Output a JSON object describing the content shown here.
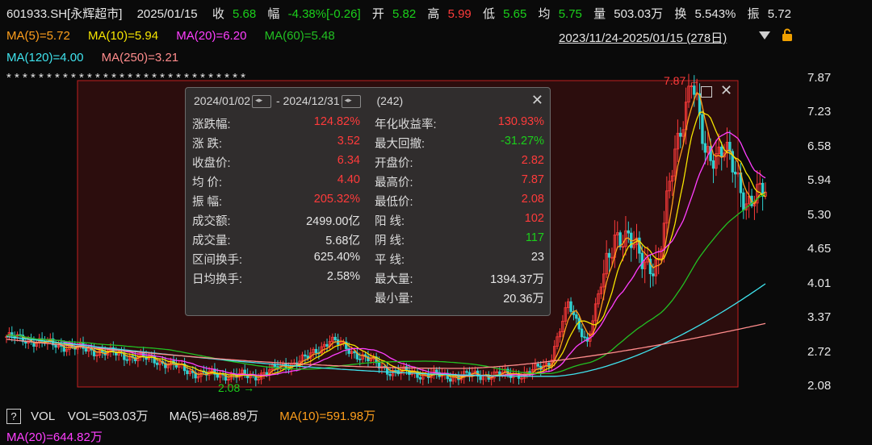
{
  "header": {
    "code_name": "601933.SH[永辉超市]",
    "date": "2025/01/15",
    "close_label": "收",
    "close_value": "5.68",
    "change_label": "幅",
    "change_value": "-4.38%[-0.26]",
    "open_label": "开",
    "open_value": "5.82",
    "high_label": "高",
    "high_value": "5.99",
    "low_label": "低",
    "low_value": "5.65",
    "avg_label": "均",
    "avg_value": "5.75",
    "volume_label": "量",
    "volume_value": "503.03万",
    "turnover_label": "换",
    "turnover_value": "5.543%",
    "amplitude_label": "振",
    "amplitude_value": "5.72"
  },
  "ma": {
    "ma5": "MA(5)=5.72",
    "ma10": "MA(10)=5.94",
    "ma20": "MA(20)=6.20",
    "ma60": "MA(60)=5.48",
    "ma120": "MA(120)=4.00",
    "ma250": "MA(250)=3.21"
  },
  "range_selector": "2023/11/24-2025/01/15 (278日)",
  "stars": "* * * *   *   *    *           * *         *    *  * * *             *      * *     *     *     *     *              * * * *    * *    *         *          *",
  "price_axis": [
    "7.87",
    "7.23",
    "6.58",
    "5.94",
    "5.30",
    "4.65",
    "4.01",
    "3.37",
    "2.72",
    "2.08"
  ],
  "annotations": {
    "high_marker": "7.87",
    "low_marker": "2.08"
  },
  "stats": {
    "date_from": "2024/01/02",
    "date_to": "2024/12/31",
    "separator": "-",
    "count": "(242)",
    "left": [
      {
        "label": "涨跌幅:",
        "value": "124.82%",
        "color": "#ff3b3b"
      },
      {
        "label": "涨  跌:",
        "value": "3.52",
        "color": "#ff3b3b"
      },
      {
        "label": "收盘价:",
        "value": "6.34",
        "color": "#ff3b3b"
      },
      {
        "label": "均  价:",
        "value": "4.40",
        "color": "#ff3b3b"
      },
      {
        "label": "振  幅:",
        "value": "205.32%",
        "color": "#ff3b3b"
      },
      {
        "label": "成交额:",
        "value": "2499.00亿",
        "color": "#e6e6e6"
      },
      {
        "label": "成交量:",
        "value": "5.68亿",
        "color": "#e6e6e6"
      },
      {
        "label": "区间换手:",
        "value": "625.40%",
        "color": "#e6e6e6"
      },
      {
        "label": "日均换手:",
        "value": "2.58%",
        "color": "#e6e6e6"
      }
    ],
    "right": [
      {
        "label": "年化收益率:",
        "value": "130.93%",
        "color": "#ff3b3b"
      },
      {
        "label": "最大回撤:",
        "value": "-31.27%",
        "color": "#1bd01b"
      },
      {
        "label": "开盘价:",
        "value": "2.82",
        "color": "#ff3b3b"
      },
      {
        "label": "最高价:",
        "value": "7.87",
        "color": "#ff3b3b"
      },
      {
        "label": "最低价:",
        "value": "2.08",
        "color": "#ff3b3b"
      },
      {
        "label": "阳  线:",
        "value": "102",
        "color": "#ff3b3b"
      },
      {
        "label": "阴  线:",
        "value": "117",
        "color": "#1bd01b"
      },
      {
        "label": "平  线:",
        "value": "23",
        "color": "#e6e6e6"
      },
      {
        "label": "最大量:",
        "value": "1394.37万",
        "color": "#e6e6e6"
      },
      {
        "label": "最小量:",
        "value": "20.36万",
        "color": "#e6e6e6"
      }
    ]
  },
  "volume": {
    "help": "?",
    "label": "VOL",
    "vol": "VOL=503.03万",
    "ma5": "MA(5)=468.89万",
    "ma10": "MA(10)=591.98万",
    "ma20": "MA(20)=644.82万"
  },
  "colors": {
    "up": "#ff3b3b",
    "down": "#1bd01b",
    "ma5": "#ff9f1c",
    "ma10": "#f5e400",
    "ma20": "#ff3fff",
    "ma60": "#22c022",
    "ma120": "#3fe3ee",
    "ma250": "#ff8c8c"
  }
}
